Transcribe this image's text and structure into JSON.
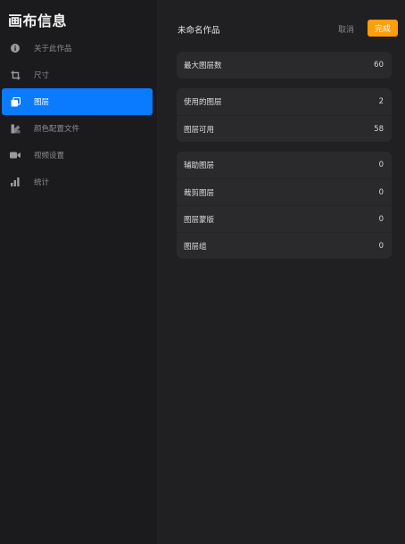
{
  "sidebar": {
    "title": "画布信息",
    "items": [
      {
        "label": "关于此作品",
        "icon": "info-icon",
        "active": false
      },
      {
        "label": "尺寸",
        "icon": "crop-icon",
        "active": false
      },
      {
        "label": "图层",
        "icon": "layers-icon",
        "active": true
      },
      {
        "label": "颜色配置文件",
        "icon": "color-profile-icon",
        "active": false
      },
      {
        "label": "视频设置",
        "icon": "video-camera-icon",
        "active": false
      },
      {
        "label": "统计",
        "icon": "bar-chart-icon",
        "active": false
      }
    ]
  },
  "header": {
    "title": "未命名作品",
    "cancel_label": "取消",
    "done_label": "完成"
  },
  "groups": [
    [
      {
        "label": "最大图层数",
        "value": "60"
      }
    ],
    [
      {
        "label": "使用的图层",
        "value": "2"
      },
      {
        "label": "图层可用",
        "value": "58"
      }
    ],
    [
      {
        "label": "辅助图层",
        "value": "0"
      },
      {
        "label": "裁剪图层",
        "value": "0"
      },
      {
        "label": "图层蒙版",
        "value": "0"
      },
      {
        "label": "图层组",
        "value": "0"
      }
    ]
  ],
  "colors": {
    "accent": "#0a7aff",
    "done_button": "#ff9d0a",
    "background": "#1c1c1e",
    "card": "#2a2a2c"
  }
}
